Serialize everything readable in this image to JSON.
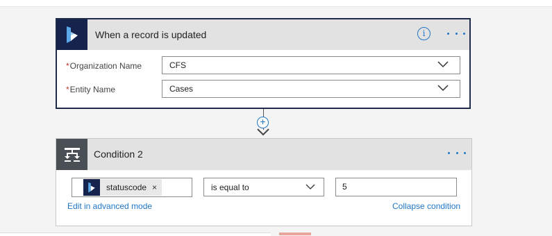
{
  "trigger": {
    "title": "When a record is updated",
    "info_glyph": "i",
    "fields": [
      {
        "label": "Organization Name",
        "required": "*",
        "value": "CFS"
      },
      {
        "label": "Entity Name",
        "required": "*",
        "value": "Cases"
      }
    ]
  },
  "connector": {
    "add_glyph": "+"
  },
  "condition": {
    "title": "Condition 2",
    "token": {
      "label": "statuscode",
      "remove_glyph": "×"
    },
    "operator": "is equal to",
    "value": "5",
    "edit_link": "Edit in advanced mode",
    "collapse_link": "Collapse condition"
  },
  "colors": {
    "accent": "#1f76c6",
    "dynamics_navy": "#15234d",
    "condition_icon_bg": "#4a4f55",
    "header_bg": "#e2e2e2"
  },
  "icons": {
    "trigger": "dynamics-365-icon",
    "condition": "condition-icon",
    "info": "info-icon",
    "more": "ellipsis-icon",
    "dropdown": "chevron-down-icon"
  }
}
